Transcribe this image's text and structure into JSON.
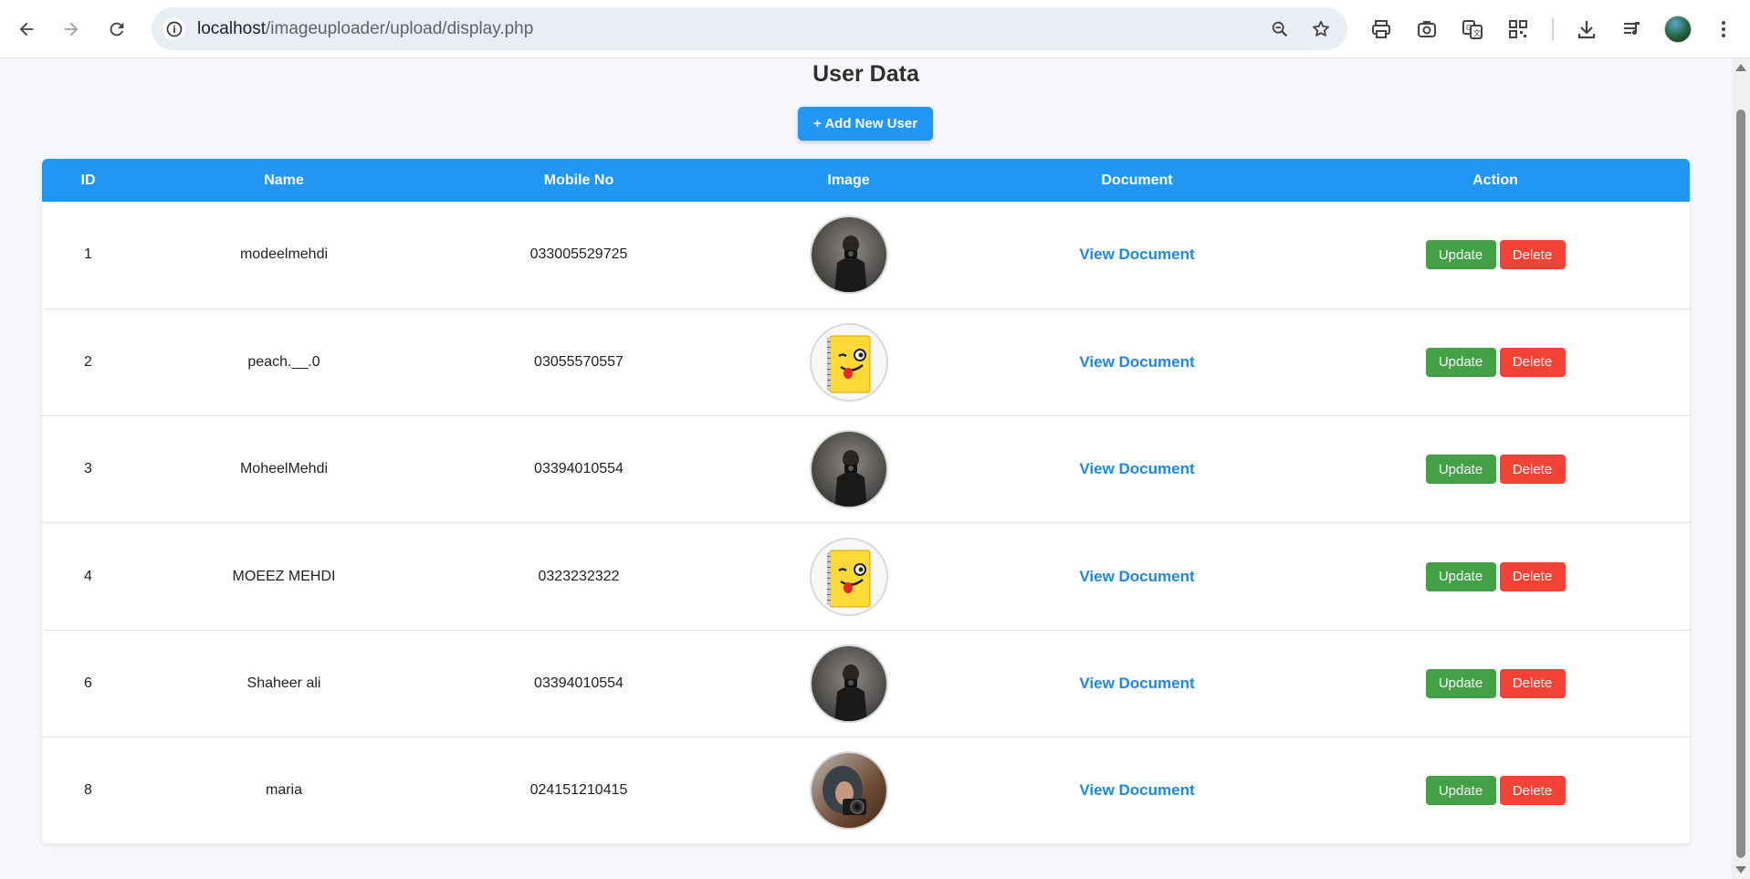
{
  "browser": {
    "url_host": "localhost",
    "url_path": "/imageuploader/upload/display.php",
    "icons": [
      "back-icon",
      "forward-icon",
      "reload-icon",
      "site-info-icon",
      "zoom-icon",
      "bookmark-star-icon",
      "print-icon",
      "screenshot-icon",
      "translate-icon",
      "qr-code-icon",
      "download-icon",
      "media-queue-icon",
      "profile-avatar",
      "more-menu-icon"
    ]
  },
  "page": {
    "title": "User Data",
    "add_button": "+ Add New User"
  },
  "table": {
    "headers": [
      "ID",
      "Name",
      "Mobile No",
      "Image",
      "Document",
      "Action"
    ],
    "rows": [
      {
        "id": "1",
        "name": "modeelmehdi",
        "mobile": "033005529725",
        "image": "photographer-photo",
        "document": "View Document",
        "update": "Update",
        "delete": "Delete"
      },
      {
        "id": "2",
        "name": "peach.__.0",
        "mobile": "03055570557",
        "image": "emoji-notebook",
        "document": "View Document",
        "update": "Update",
        "delete": "Delete"
      },
      {
        "id": "3",
        "name": "MoheelMehdi",
        "mobile": "03394010554",
        "image": "photographer-photo",
        "document": "View Document",
        "update": "Update",
        "delete": "Delete"
      },
      {
        "id": "4",
        "name": "MOEEZ MEHDI",
        "mobile": "0323232322",
        "image": "emoji-notebook",
        "document": "View Document",
        "update": "Update",
        "delete": "Delete"
      },
      {
        "id": "6",
        "name": "Shaheer ali",
        "mobile": "03394010554",
        "image": "photographer-photo",
        "document": "View Document",
        "update": "Update",
        "delete": "Delete"
      },
      {
        "id": "8",
        "name": "maria",
        "mobile": "024151210415",
        "image": "camera-girl-photo",
        "document": "View Document",
        "update": "Update",
        "delete": "Delete"
      }
    ]
  },
  "colors": {
    "primary": "#2196f3",
    "update": "#43a047",
    "delete": "#f44336",
    "link": "#1e88e5",
    "background": "#f5f7fb"
  }
}
